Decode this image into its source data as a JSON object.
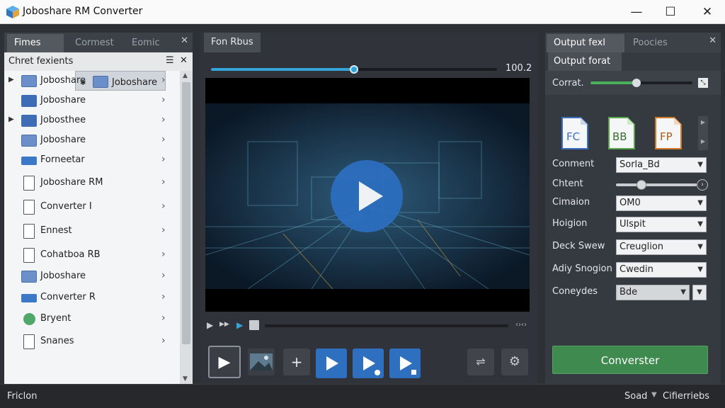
{
  "app": {
    "title": "Joboshare RM Converter",
    "accent": "#35a3d8",
    "convert_color": "#3e8a4f"
  },
  "window": {
    "min": "—",
    "max": "☐",
    "close": "✕"
  },
  "left_panel": {
    "tabs": [
      "Fimes",
      "Cormest",
      "Eomic"
    ],
    "header": "Chret fexients",
    "items": [
      {
        "label": "Joboshare",
        "icon": "folder-icon",
        "expand": "arrow"
      },
      {
        "label": "Joboshare",
        "icon": "folder-icon",
        "expand": "arrow"
      },
      {
        "label": "Joboshare",
        "icon": "play-icon",
        "expand": ""
      },
      {
        "label": "Jobosthee",
        "icon": "puzzle-icon",
        "expand": "arrow"
      },
      {
        "label": "Joboshare",
        "icon": "folder-icon",
        "expand": ""
      },
      {
        "label": "Forneetar",
        "icon": "bar-icon",
        "expand": ""
      },
      {
        "label": "Joboshare RM",
        "icon": "document-icon",
        "expand": ""
      },
      {
        "label": "Converter I",
        "icon": "document-icon",
        "expand": ""
      },
      {
        "label": "Ennest",
        "icon": "document-icon",
        "expand": ""
      },
      {
        "label": "Cohatboa RB",
        "icon": "document-icon",
        "expand": ""
      },
      {
        "label": "Joboshare",
        "icon": "folder-icon",
        "expand": ""
      },
      {
        "label": "Converter R",
        "icon": "bar-icon",
        "expand": ""
      },
      {
        "label": "Bryent",
        "icon": "green-circle-icon",
        "expand": ""
      },
      {
        "label": "Snanes",
        "icon": "document-icon",
        "expand": ""
      }
    ]
  },
  "center": {
    "tab": "Fon Rbus",
    "progress_label": "100.2",
    "progress_fraction": 0.5,
    "mini_controls": [
      "▶",
      "▶▶",
      "▶"
    ],
    "time_end": "‹›‹›"
  },
  "right_panel": {
    "tabs": [
      "Output fexl",
      "Poocies"
    ],
    "sub_tab": "Output forat",
    "corrat_label": "Corrat.",
    "corrat_level": 0.45,
    "formats": [
      {
        "text": "FC",
        "color": "#3d6fbf"
      },
      {
        "text": "BB",
        "color": "#5aa64a"
      },
      {
        "text": "FP",
        "color": "#d27a2a"
      }
    ],
    "fields": [
      {
        "label": "Conment",
        "value": "Sorla_Bd"
      },
      {
        "label": "Chtent",
        "value": ""
      },
      {
        "label": "Cimaion",
        "value": "OM0"
      },
      {
        "label": "Hoigion",
        "value": "Ulspit"
      },
      {
        "label": "Deck Swew",
        "value": "Creuglion"
      },
      {
        "label": "Adiy Snogion",
        "value": "Cwedin"
      },
      {
        "label": "Coneydes",
        "value": "Bde"
      }
    ],
    "chtent_level": 0.32,
    "convert_button": "Converster"
  },
  "status": {
    "left": "Friclon",
    "right_a": "Soad",
    "right_b": "Cifierriebs"
  }
}
